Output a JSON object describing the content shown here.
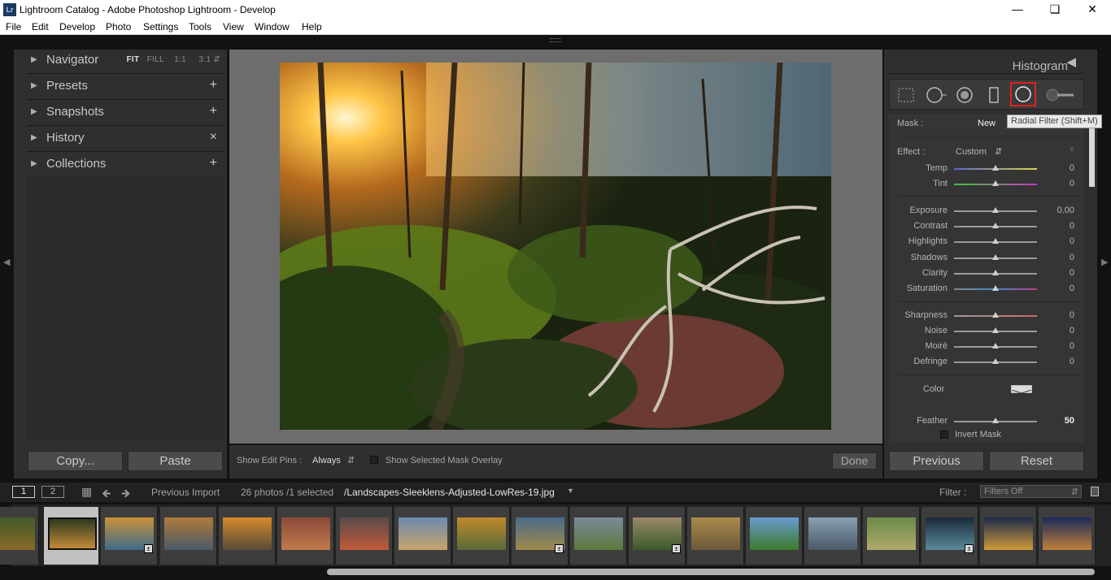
{
  "window": {
    "title": "Lightroom Catalog - Adobe Photoshop Lightroom - Develop",
    "app_icon": "Lr"
  },
  "menu": [
    "File",
    "Edit",
    "Develop",
    "Photo",
    "Settings",
    "Tools",
    "View",
    "Window",
    "Help"
  ],
  "left_panel": {
    "navigator": {
      "label": "Navigator",
      "zoom": [
        "FIT",
        "FILL",
        "1:1",
        "3:1"
      ]
    },
    "panels": [
      {
        "label": "Presets",
        "action": "+"
      },
      {
        "label": "Snapshots",
        "action": "+"
      },
      {
        "label": "History",
        "action": "×"
      },
      {
        "label": "Collections",
        "action": "+"
      }
    ],
    "copy_label": "Copy...",
    "paste_label": "Paste"
  },
  "toolbar": {
    "edit_pins_label": "Show Edit Pins :",
    "edit_pins_value": "Always",
    "mask_overlay_label": "Show Selected Mask Overlay",
    "done_label": "Done"
  },
  "right_panel": {
    "histogram_label": "Histogram",
    "tooltip": "Radial Filter (Shift+M)",
    "mask_label": "Mask :",
    "mask_new": "New",
    "effect_label": "Effect :",
    "effect_value": "Custom",
    "sliders_wb": [
      {
        "name": "Temp",
        "value": "0"
      },
      {
        "name": "Tint",
        "value": "0"
      }
    ],
    "sliders_tone": [
      {
        "name": "Exposure",
        "value": "0.00"
      },
      {
        "name": "Contrast",
        "value": "0"
      },
      {
        "name": "Highlights",
        "value": "0"
      },
      {
        "name": "Shadows",
        "value": "0"
      },
      {
        "name": "Clarity",
        "value": "0"
      },
      {
        "name": "Saturation",
        "value": "0"
      }
    ],
    "sliders_detail": [
      {
        "name": "Sharpness",
        "value": "0"
      },
      {
        "name": "Noise",
        "value": "0"
      },
      {
        "name": "Moiré",
        "value": "0"
      },
      {
        "name": "Defringe",
        "value": "0"
      }
    ],
    "color_label": "Color",
    "feather_label": "Feather",
    "feather_value": "50",
    "invert_label": "Invert Mask",
    "previous_label": "Previous",
    "reset_label": "Reset"
  },
  "filmstrip_bar": {
    "screen1": "1",
    "screen2": "2",
    "source": "Previous Import",
    "count": "26 photos /1 selected",
    "filename": "/Landscapes-Sleeklens-Adjusted-LowRes-19.jpg",
    "filter_label": "Filter :",
    "filter_value": "Filters Off"
  },
  "thumbnails": [
    {
      "c1": "#3f5a2a",
      "c2": "#8a6a2a",
      "badge": false,
      "selected": false
    },
    {
      "c1": "#2c3a1e",
      "c2": "#c58a3a",
      "badge": false,
      "selected": true
    },
    {
      "c1": "#c8913a",
      "c2": "#3f6b8a",
      "badge": true,
      "selected": false
    },
    {
      "c1": "#b07a3a",
      "c2": "#4a5a6a",
      "badge": false,
      "selected": false
    },
    {
      "c1": "#d48a2a",
      "c2": "#5a4a3a",
      "badge": false,
      "selected": false
    },
    {
      "c1": "#8a4a3a",
      "c2": "#c07a4a",
      "badge": false,
      "selected": false
    },
    {
      "c1": "#5a4a4a",
      "c2": "#c05a3a",
      "badge": false,
      "selected": false
    },
    {
      "c1": "#6a8ab0",
      "c2": "#caa46a",
      "badge": false,
      "selected": false
    },
    {
      "c1": "#c08a2a",
      "c2": "#5a6a3a",
      "badge": false,
      "selected": false
    },
    {
      "c1": "#4a6a8a",
      "c2": "#a08a4a",
      "badge": true,
      "selected": false
    },
    {
      "c1": "#7a8a9a",
      "c2": "#5a7a3a",
      "badge": false,
      "selected": false
    },
    {
      "c1": "#9a8a6a",
      "c2": "#3a5a2a",
      "badge": true,
      "selected": false
    },
    {
      "c1": "#aa8a4a",
      "c2": "#6a5a3a",
      "badge": false,
      "selected": false
    },
    {
      "c1": "#6a9ad0",
      "c2": "#3a7a2a",
      "badge": false,
      "selected": false
    },
    {
      "c1": "#8aa0b0",
      "c2": "#4a5a6a",
      "badge": false,
      "selected": false
    },
    {
      "c1": "#6a8a4a",
      "c2": "#b0aa6a",
      "badge": false,
      "selected": false
    },
    {
      "c1": "#1a2a3a",
      "c2": "#5a8a9a",
      "badge": true,
      "selected": false
    },
    {
      "c1": "#1a2a4a",
      "c2": "#d09a3a",
      "badge": false,
      "selected": false
    },
    {
      "c1": "#1a2a5a",
      "c2": "#c0803a",
      "badge": false,
      "selected": false
    }
  ],
  "colors": {
    "tool_highlight": "#e0221e",
    "panel_bg": "#2f2f2f",
    "canvas_bg": "#6d6d6d"
  }
}
